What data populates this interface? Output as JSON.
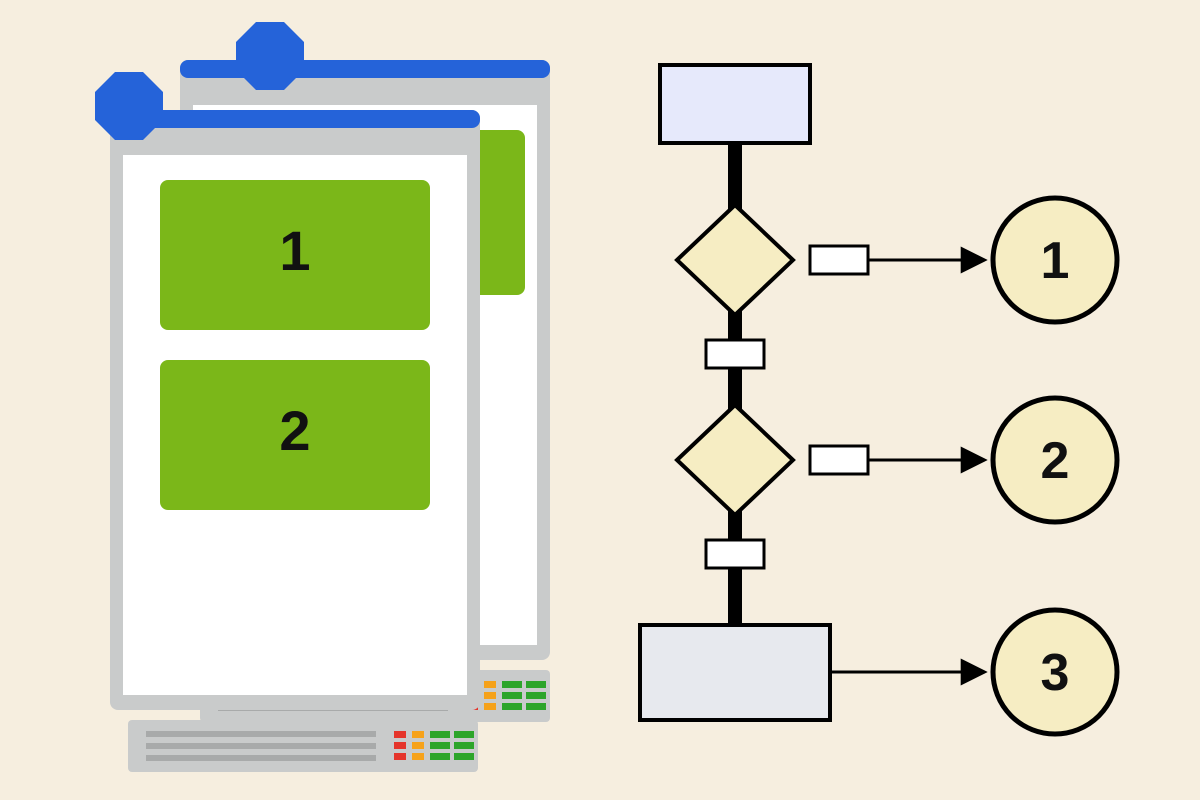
{
  "colors": {
    "bg": "#f6eedf",
    "windowFrame": "#c9cbcb",
    "windowInner": "#ffffff",
    "accentBar": "#2563d9",
    "card": "#7bb719",
    "serverBody": "#c9cbcb",
    "ledRed": "#e5352b",
    "ledAmber": "#f6a21a",
    "ledGreen": "#2da52a",
    "flowStroke": "#000000",
    "startFill": "#e6e9fb",
    "diamondFill": "#f6edc3",
    "smallBoxFill": "#ffffff",
    "processFill": "#e7e9ee",
    "circleFill": "#f6edc3"
  },
  "windows": {
    "front": {
      "cards": [
        "1",
        "2"
      ]
    }
  },
  "flow": {
    "circles": [
      "1",
      "2",
      "3"
    ]
  }
}
